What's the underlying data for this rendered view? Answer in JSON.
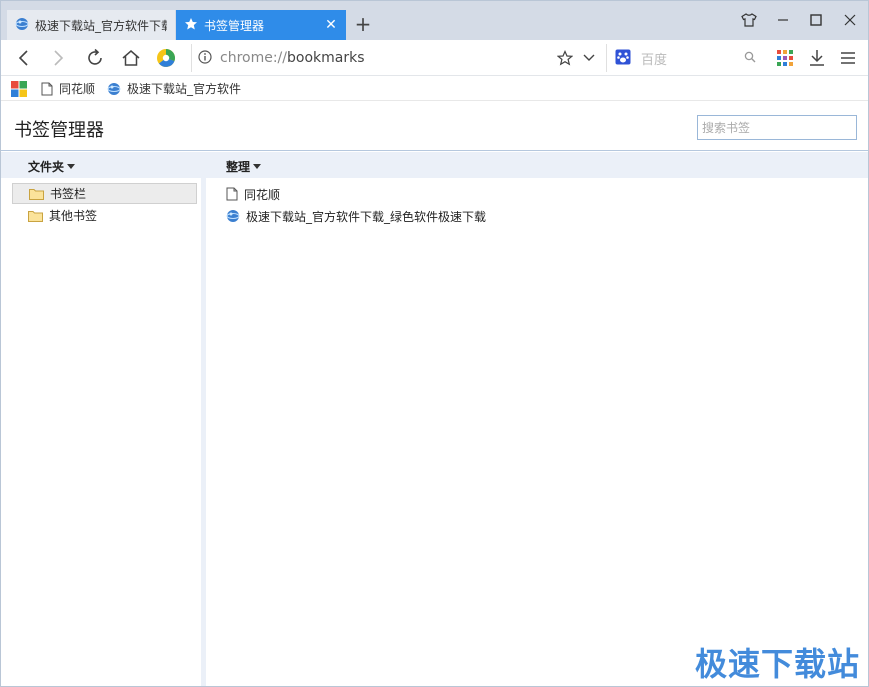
{
  "tabs": [
    {
      "title": "极速下载站_官方软件下载",
      "active": false
    },
    {
      "title": "书签管理器",
      "active": true
    }
  ],
  "toolbar": {
    "address_scheme": "chrome://",
    "address_path": "bookmarks",
    "search_placeholder": "百度"
  },
  "bookmarks_bar": [
    {
      "label": "同花顺"
    },
    {
      "label": "极速下载站_官方软件"
    }
  ],
  "page": {
    "title": "书签管理器",
    "search_placeholder": "搜索书签"
  },
  "columns": {
    "folders_label": "文件夹",
    "organize_label": "整理"
  },
  "tree": [
    {
      "label": "书签栏",
      "selected": true
    },
    {
      "label": "其他书签",
      "selected": false
    }
  ],
  "list": [
    {
      "label": "同花顺",
      "icon": "page-icon"
    },
    {
      "label": "极速下载站_官方软件下载_绿色软件极速下载",
      "icon": "globe-icon"
    }
  ],
  "watermark": "极速下载站",
  "colors": {
    "accent": "#2f8ce9",
    "tabstrip": "#d4dbe6",
    "column_header": "#ebf0f8"
  }
}
